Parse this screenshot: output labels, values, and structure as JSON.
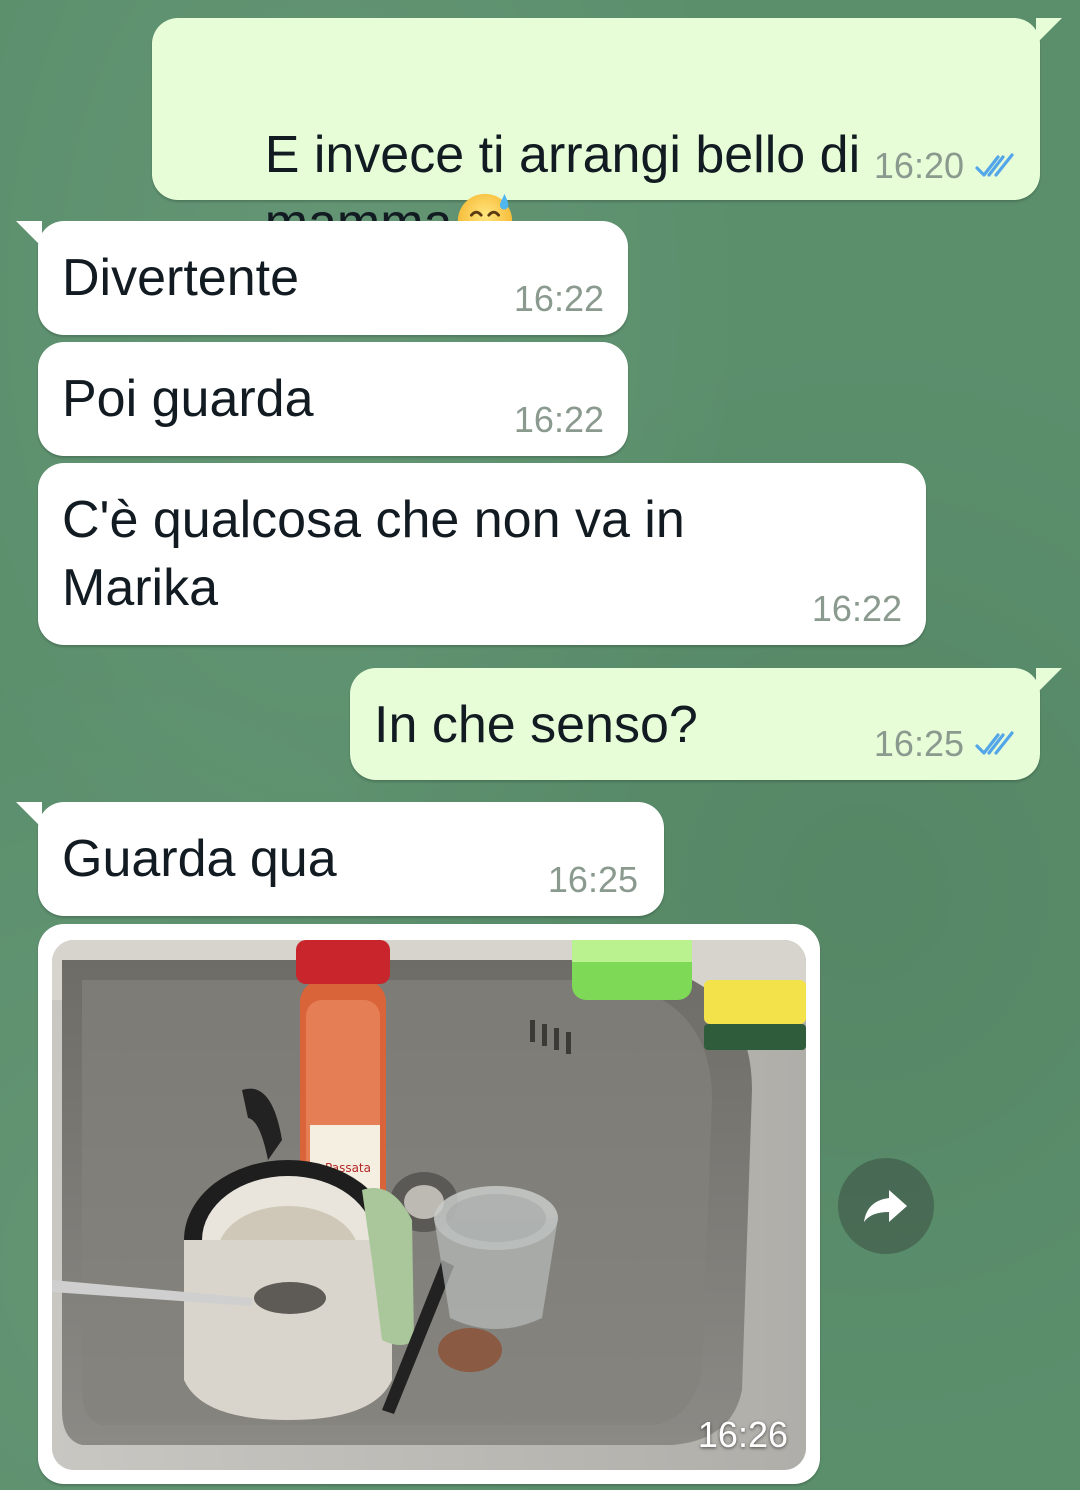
{
  "messages": [
    {
      "id": "m1",
      "direction": "outgoing",
      "line1": "E invece ti arrangi bello di",
      "line2": "mamma",
      "emoji": "grinning-face-with-sweat",
      "time": "16:20",
      "status": "read"
    },
    {
      "id": "m2",
      "direction": "incoming",
      "text": "Divertente",
      "time": "16:22"
    },
    {
      "id": "m3",
      "direction": "incoming",
      "text": "Poi guarda",
      "time": "16:22"
    },
    {
      "id": "m4",
      "direction": "incoming",
      "line1": "C'è qualcosa che non va in",
      "line2": "Marika",
      "time": "16:22"
    },
    {
      "id": "m5",
      "direction": "outgoing",
      "text": "In che senso?",
      "time": "16:25",
      "status": "read"
    },
    {
      "id": "m6",
      "direction": "incoming",
      "text": "Guarda qua",
      "time": "16:25"
    }
  ],
  "photo_message": {
    "direction": "incoming",
    "time": "16:26",
    "content": "photo-of-sink",
    "jar_label": "Passata"
  },
  "forward_button": {
    "icon": "forward-icon"
  },
  "colors": {
    "wallpaper": "#5b8f6c",
    "outgoing_bubble": "#e7fdd8",
    "incoming_bubble": "#ffffff",
    "read_ticks": "#53a6e8",
    "meta_text": "#8a9a8e"
  }
}
